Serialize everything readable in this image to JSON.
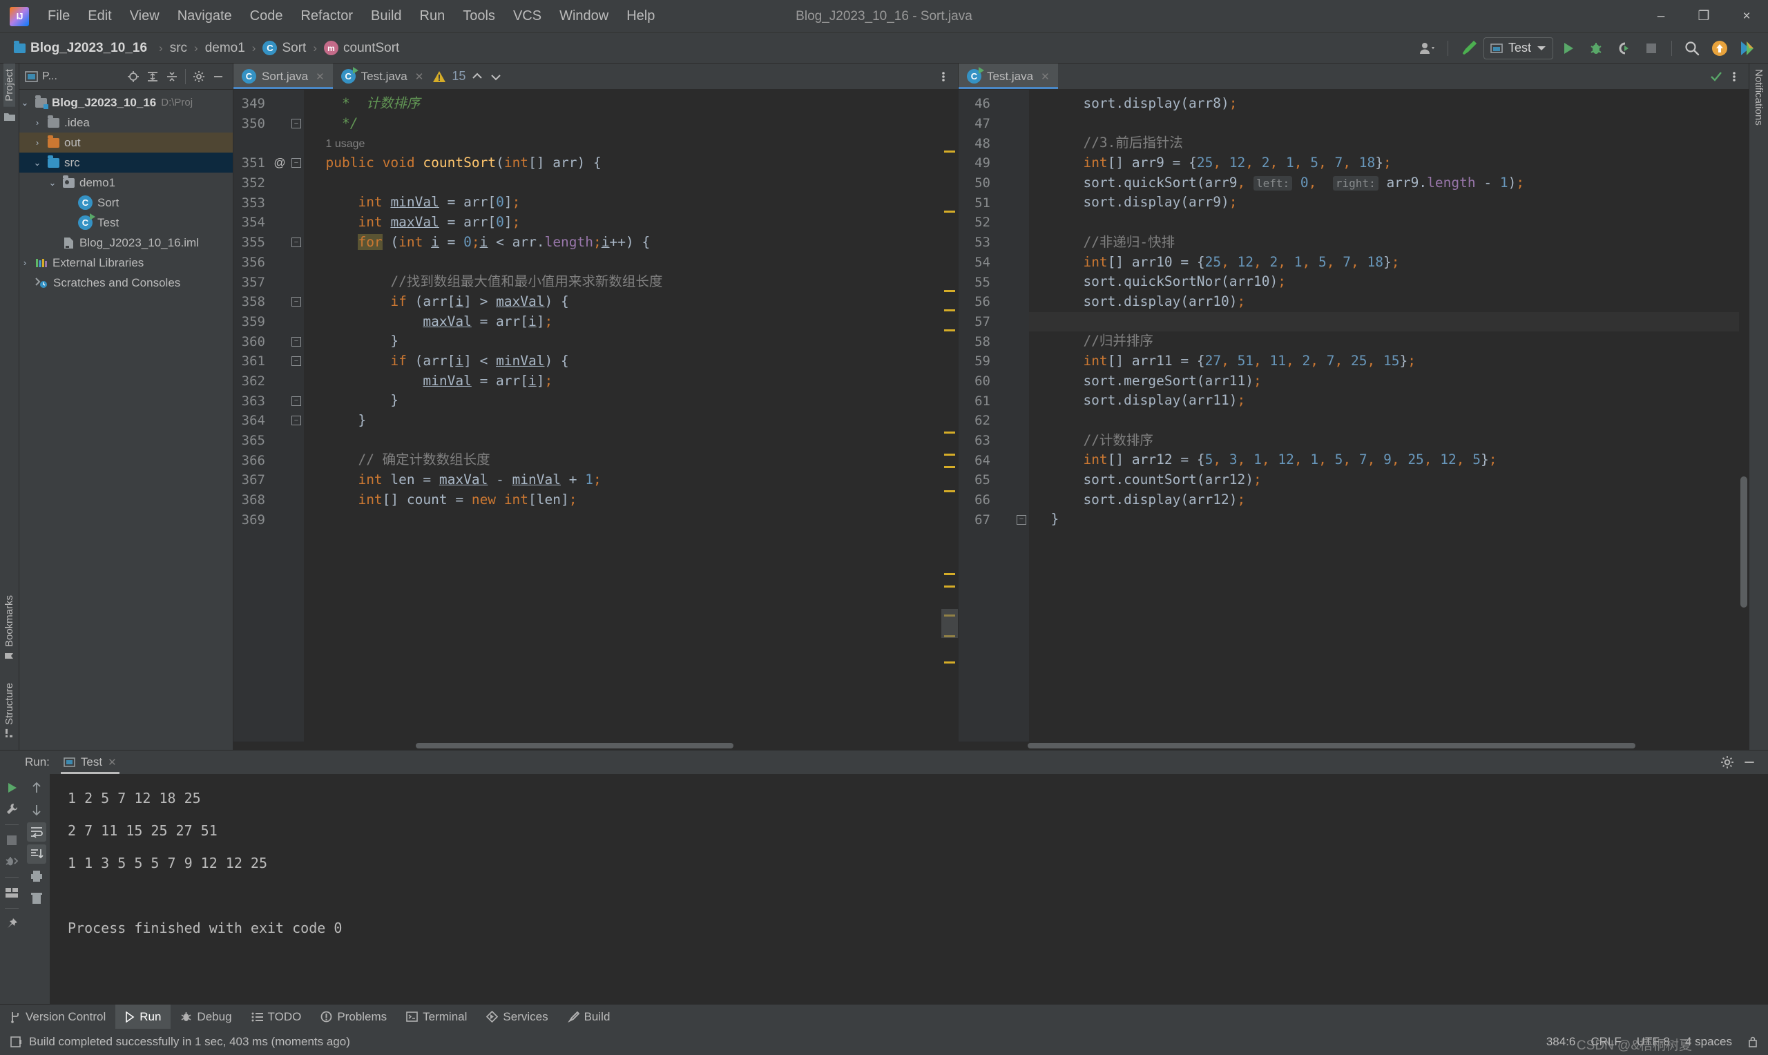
{
  "window": {
    "title": "Blog_J2023_10_16 - Sort.java",
    "minimize": "–",
    "maximize": "❐",
    "close": "×"
  },
  "menu": [
    "File",
    "Edit",
    "View",
    "Navigate",
    "Code",
    "Refactor",
    "Build",
    "Run",
    "Tools",
    "VCS",
    "Window",
    "Help"
  ],
  "breadcrumb": [
    {
      "label": "Blog_J2023_10_16",
      "icon": "project-icon",
      "bold": true
    },
    {
      "label": "src",
      "icon": "folder-icon",
      "bold": false
    },
    {
      "label": "demo1",
      "icon": "package-icon",
      "bold": false
    },
    {
      "label": "Sort",
      "icon": "class-icon",
      "bold": false
    },
    {
      "label": "countSort",
      "icon": "method-icon",
      "bold": false
    }
  ],
  "toolbar": {
    "account_label": "",
    "run_config": "Test",
    "run_tooltip": "Run",
    "debug_tooltip": "Debug",
    "coverage_tooltip": "Run with Coverage",
    "stop_tooltip": "Stop",
    "search_tooltip": "Search Everywhere",
    "update_tooltip": "Update Project",
    "ide_tooltip": "IDE and Project Settings"
  },
  "left_strip": {
    "top": [
      "Project"
    ],
    "bottom": [
      "Bookmarks",
      "Structure"
    ]
  },
  "right_strip": {
    "items": [
      "Notifications"
    ]
  },
  "project": {
    "header_label": "P...",
    "tree": [
      {
        "depth": 0,
        "arrow": "⌄",
        "icon": "project-folder-icon",
        "label": "Blog_J2023_10_16",
        "path": "D:\\Proj",
        "bold": true,
        "state": "none"
      },
      {
        "depth": 1,
        "arrow": "›",
        "icon": "folder-icon",
        "label": ".idea",
        "path": "",
        "bold": false,
        "state": "none"
      },
      {
        "depth": 1,
        "arrow": "›",
        "icon": "folder-orange-icon",
        "label": "out",
        "path": "",
        "bold": false,
        "state": "hover"
      },
      {
        "depth": 1,
        "arrow": "⌄",
        "icon": "folder-blue-icon",
        "label": "src",
        "path": "",
        "bold": false,
        "state": "selected"
      },
      {
        "depth": 2,
        "arrow": "⌄",
        "icon": "package-icon",
        "label": "demo1",
        "path": "",
        "bold": false,
        "state": "none"
      },
      {
        "depth": 3,
        "arrow": "",
        "icon": "class-icon",
        "label": "Sort",
        "path": "",
        "bold": false,
        "state": "none"
      },
      {
        "depth": 3,
        "arrow": "",
        "icon": "runnable-class-icon",
        "label": "Test",
        "path": "",
        "bold": false,
        "state": "none"
      },
      {
        "depth": 2,
        "arrow": "",
        "icon": "iml-file-icon",
        "label": "Blog_J2023_10_16.iml",
        "path": "",
        "bold": false,
        "state": "none"
      },
      {
        "depth": 0,
        "arrow": "›",
        "icon": "library-icon",
        "label": "External Libraries",
        "path": "",
        "bold": false,
        "state": "none"
      },
      {
        "depth": 0,
        "arrow": "",
        "icon": "scratches-icon",
        "label": "Scratches and Consoles",
        "path": "",
        "bold": false,
        "state": "none"
      }
    ]
  },
  "editor_left": {
    "tabs": [
      {
        "label": "Sort.java",
        "icon": "class-icon",
        "active": true
      },
      {
        "label": "Test.java",
        "icon": "runnable-class-icon",
        "active": false
      }
    ],
    "warning_count": "15",
    "first_line": 349,
    "usage_hint": "1 usage",
    "lines": [
      {
        "n": 349,
        "annot": "",
        "fold": "",
        "html": "    <span class=\"doc\">*  计数排序</span>"
      },
      {
        "n": 350,
        "annot": "",
        "fold": "end",
        "html": "    <span class=\"doc\">*/</span>"
      },
      {
        "n": null,
        "annot": "",
        "fold": "",
        "html": "  <span class=\"usage\">1 usage</span>"
      },
      {
        "n": 351,
        "annot": "@",
        "fold": "start",
        "html": "  <span class=\"kw\">public</span> <span class=\"kw\">void</span> <span class=\"fn\">countSort</span>(<span class=\"kw\">int</span>[] arr) <span class=\"punct\">{</span>"
      },
      {
        "n": 352,
        "annot": "",
        "fold": "",
        "html": ""
      },
      {
        "n": 353,
        "annot": "",
        "fold": "",
        "html": "      <span class=\"kw\">int</span> <span class=\"u\">minVal</span> = arr[<span class=\"num\">0</span>]<span class=\"semi\">;</span>"
      },
      {
        "n": 354,
        "annot": "",
        "fold": "",
        "html": "      <span class=\"kw\">int</span> <span class=\"u\">maxVal</span> = arr[<span class=\"num\">0</span>]<span class=\"semi\">;</span>"
      },
      {
        "n": 355,
        "annot": "",
        "fold": "start",
        "html": "      <span class=\"kwhl\">for</span> (<span class=\"kw\">int</span> <span class=\"u\">i</span> = <span class=\"num\">0</span><span class=\"semi\">;</span><span class=\"u\">i</span> &lt; arr.<span class=\"fld\">length</span><span class=\"semi\">;</span><span class=\"u\">i</span>++) {"
      },
      {
        "n": 356,
        "annot": "",
        "fold": "",
        "html": ""
      },
      {
        "n": 357,
        "annot": "",
        "fold": "",
        "html": "          <span class=\"cmt\">//找到数组最大值和最小值用来求新数组长度</span>"
      },
      {
        "n": 358,
        "annot": "",
        "fold": "start",
        "html": "          <span class=\"kw\">if</span> (arr[<span class=\"u\">i</span>] &gt; <span class=\"u\">maxVal</span>) {"
      },
      {
        "n": 359,
        "annot": "",
        "fold": "",
        "html": "              <span class=\"u\">maxVal</span> = arr[<span class=\"u\">i</span>]<span class=\"semi\">;</span>"
      },
      {
        "n": 360,
        "annot": "",
        "fold": "end",
        "html": "          }"
      },
      {
        "n": 361,
        "annot": "",
        "fold": "start",
        "html": "          <span class=\"kw\">if</span> (arr[<span class=\"u\">i</span>] &lt; <span class=\"u\">minVal</span>) {"
      },
      {
        "n": 362,
        "annot": "",
        "fold": "",
        "html": "              <span class=\"u\">minVal</span> = arr[<span class=\"u\">i</span>]<span class=\"semi\">;</span>"
      },
      {
        "n": 363,
        "annot": "",
        "fold": "end",
        "html": "          }"
      },
      {
        "n": 364,
        "annot": "",
        "fold": "end",
        "html": "      }"
      },
      {
        "n": 365,
        "annot": "",
        "fold": "",
        "html": ""
      },
      {
        "n": 366,
        "annot": "",
        "fold": "",
        "html": "      <span class=\"cmt\">// 确定计数数组长度</span>"
      },
      {
        "n": 367,
        "annot": "",
        "fold": "",
        "html": "      <span class=\"kw\">int</span> len = <span class=\"u\">maxVal</span> - <span class=\"u\">minVal</span> + <span class=\"num\">1</span><span class=\"semi\">;</span>"
      },
      {
        "n": 368,
        "annot": "",
        "fold": "",
        "html": "      <span class=\"kw\">int</span>[] count = <span class=\"kw\">new</span> <span class=\"kw\">int</span>[len]<span class=\"semi\">;</span>"
      },
      {
        "n": 369,
        "annot": "",
        "fold": "",
        "html": ""
      }
    ]
  },
  "editor_right": {
    "tabs": [
      {
        "label": "Test.java",
        "icon": "runnable-class-icon",
        "active": true
      }
    ],
    "lines": [
      {
        "n": 46,
        "annot": "",
        "fold": "",
        "hl": false,
        "html": "      sort.display(arr8)<span class=\"semi\">;</span>"
      },
      {
        "n": 47,
        "annot": "",
        "fold": "",
        "hl": false,
        "html": ""
      },
      {
        "n": 48,
        "annot": "",
        "fold": "",
        "hl": false,
        "html": "      <span class=\"cmt\">//3.前后指针法</span>"
      },
      {
        "n": 49,
        "annot": "",
        "fold": "",
        "hl": false,
        "html": "      <span class=\"kw\">int</span>[] arr9 = {<span class=\"num\">25</span><span class=\"semi\">,</span> <span class=\"num\">12</span><span class=\"semi\">,</span> <span class=\"num\">2</span><span class=\"semi\">,</span> <span class=\"num\">1</span><span class=\"semi\">,</span> <span class=\"num\">5</span><span class=\"semi\">,</span> <span class=\"num\">7</span><span class=\"semi\">,</span> <span class=\"num\">18</span>}<span class=\"semi\">;</span>"
      },
      {
        "n": 50,
        "annot": "",
        "fold": "",
        "hl": false,
        "html": "      sort.quickSort(arr9<span class=\"semi\">,</span> <span class=\"hint\">left:</span> <span class=\"num\">0</span><span class=\"semi\">,</span>  <span class=\"hint\">right:</span> arr9.<span class=\"fld\">length</span> - <span class=\"num\">1</span>)<span class=\"semi\">;</span>"
      },
      {
        "n": 51,
        "annot": "",
        "fold": "",
        "hl": false,
        "html": "      sort.display(arr9)<span class=\"semi\">;</span>"
      },
      {
        "n": 52,
        "annot": "",
        "fold": "",
        "hl": false,
        "html": ""
      },
      {
        "n": 53,
        "annot": "",
        "fold": "",
        "hl": false,
        "html": "      <span class=\"cmt\">//非递归-快排</span>"
      },
      {
        "n": 54,
        "annot": "",
        "fold": "",
        "hl": false,
        "html": "      <span class=\"kw\">int</span>[] arr10 = {<span class=\"num\">25</span><span class=\"semi\">,</span> <span class=\"num\">12</span><span class=\"semi\">,</span> <span class=\"num\">2</span><span class=\"semi\">,</span> <span class=\"num\">1</span><span class=\"semi\">,</span> <span class=\"num\">5</span><span class=\"semi\">,</span> <span class=\"num\">7</span><span class=\"semi\">,</span> <span class=\"num\">18</span>}<span class=\"semi\">;</span>"
      },
      {
        "n": 55,
        "annot": "",
        "fold": "",
        "hl": false,
        "html": "      sort.quickSortNor(arr10)<span class=\"semi\">;</span>"
      },
      {
        "n": 56,
        "annot": "",
        "fold": "",
        "hl": false,
        "html": "      sort.display(arr10)<span class=\"semi\">;</span>"
      },
      {
        "n": 57,
        "annot": "",
        "fold": "",
        "hl": true,
        "html": ""
      },
      {
        "n": 58,
        "annot": "",
        "fold": "",
        "hl": false,
        "html": "      <span class=\"cmt\">//归并排序</span>"
      },
      {
        "n": 59,
        "annot": "",
        "fold": "",
        "hl": false,
        "html": "      <span class=\"kw\">int</span>[] arr11 = {<span class=\"num\">27</span><span class=\"semi\">,</span> <span class=\"num\">51</span><span class=\"semi\">,</span> <span class=\"num\">11</span><span class=\"semi\">,</span> <span class=\"num\">2</span><span class=\"semi\">,</span> <span class=\"num\">7</span><span class=\"semi\">,</span> <span class=\"num\">25</span><span class=\"semi\">,</span> <span class=\"num\">15</span>}<span class=\"semi\">;</span>"
      },
      {
        "n": 60,
        "annot": "",
        "fold": "",
        "hl": false,
        "html": "      sort.mergeSort(arr11)<span class=\"semi\">;</span>"
      },
      {
        "n": 61,
        "annot": "",
        "fold": "",
        "hl": false,
        "html": "      sort.display(arr11)<span class=\"semi\">;</span>"
      },
      {
        "n": 62,
        "annot": "",
        "fold": "",
        "hl": false,
        "html": ""
      },
      {
        "n": 63,
        "annot": "",
        "fold": "",
        "hl": false,
        "html": "      <span class=\"cmt\">//计数排序</span>"
      },
      {
        "n": 64,
        "annot": "",
        "fold": "",
        "hl": false,
        "html": "      <span class=\"kw\">int</span>[] arr12 = {<span class=\"num\">5</span><span class=\"semi\">,</span> <span class=\"num\">3</span><span class=\"semi\">,</span> <span class=\"num\">1</span><span class=\"semi\">,</span> <span class=\"num\">12</span><span class=\"semi\">,</span> <span class=\"num\">1</span><span class=\"semi\">,</span> <span class=\"num\">5</span><span class=\"semi\">,</span> <span class=\"num\">7</span><span class=\"semi\">,</span> <span class=\"num\">9</span><span class=\"semi\">,</span> <span class=\"num\">25</span><span class=\"semi\">,</span> <span class=\"num\">12</span><span class=\"semi\">,</span> <span class=\"num\">5</span>}<span class=\"semi\">;</span>"
      },
      {
        "n": 65,
        "annot": "",
        "fold": "",
        "hl": false,
        "html": "      sort.countSort(arr12)<span class=\"semi\">;</span>"
      },
      {
        "n": 66,
        "annot": "",
        "fold": "",
        "hl": false,
        "html": "      sort.display(arr12)<span class=\"semi\">;</span>"
      },
      {
        "n": 67,
        "annot": "",
        "fold": "end",
        "hl": false,
        "html": "  }"
      }
    ]
  },
  "run_panel": {
    "label": "Run:",
    "tab": "Test",
    "console": [
      "1 2 5 7 12 18 25",
      "2 7 11 15 25 27 51",
      "1 1 3 5 5 5 7 9 12 12 25",
      "",
      "Process finished with exit code 0"
    ]
  },
  "tool_windows": [
    {
      "label": "Version Control",
      "icon": "branch-icon",
      "active": false
    },
    {
      "label": "Run",
      "icon": "run-icon",
      "active": true
    },
    {
      "label": "Debug",
      "icon": "debug-icon",
      "active": false
    },
    {
      "label": "TODO",
      "icon": "todo-icon",
      "active": false
    },
    {
      "label": "Problems",
      "icon": "problems-icon",
      "active": false
    },
    {
      "label": "Terminal",
      "icon": "terminal-icon",
      "active": false
    },
    {
      "label": "Services",
      "icon": "services-icon",
      "active": false
    },
    {
      "label": "Build",
      "icon": "build-icon",
      "active": false
    }
  ],
  "status": {
    "message": "Build completed successfully in 1 sec, 403 ms (moments ago)",
    "caret": "384:6",
    "line_sep": "CRLF",
    "encoding": "UTF-8",
    "indent": "4 spaces",
    "watermark": "CSDN @&梧桐树夏"
  },
  "colors": {
    "accent": "#4a88c7",
    "warning": "#d6ad28",
    "run_green": "#59a869",
    "selection": "#0d293e",
    "editor_bg": "#2b2b2b",
    "panel_bg": "#3c3f41"
  }
}
